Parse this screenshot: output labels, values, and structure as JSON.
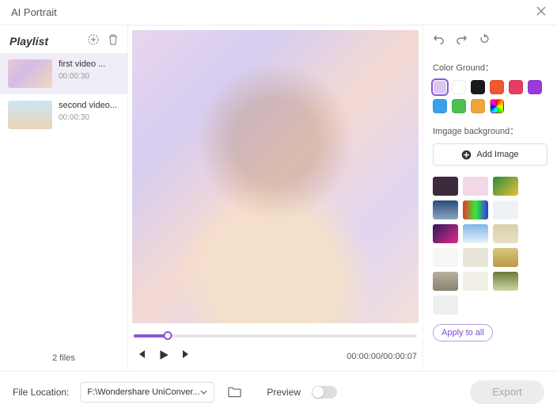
{
  "title": "AI Portrait",
  "playlist": {
    "heading": "Playlist",
    "items": [
      {
        "name": "first video ...",
        "duration": "00:00:30"
      },
      {
        "name": "second video...",
        "duration": "00:00:30"
      }
    ],
    "countLabel": "2 files"
  },
  "preview": {
    "time": "00:00:00/00:00:07"
  },
  "right": {
    "colorGroundLabel": "Color Ground：",
    "imageBgLabel": "Imgage background：",
    "addImageLabel": "Add Image",
    "applyLabel": "Apply to all",
    "colors": [
      "#d7c9f3",
      "#ffffff",
      "#1a1a1a",
      "#f0582e",
      "#e83c64",
      "#9b3ad6",
      "#3aa0ee",
      "#4fbf53",
      "#f1a43a",
      "rainbow"
    ],
    "selectedColorIndex": 0,
    "bgThumbs": [
      "#3b2b3c",
      "#f1d8e6",
      "linear-gradient(135deg,#2d8a3a,#e6c23a)",
      "linear-gradient(180deg,#2a4a7a,#8aa6c2)",
      "linear-gradient(90deg,#e33,#3e3,#33e)",
      "#eef2f5",
      "linear-gradient(135deg,#2b1a5a,#e32a8a)",
      "linear-gradient(180deg,#7db6e6,#e9f3fa)",
      "linear-gradient(180deg,#d9cfa8,#e9e0c4)",
      "#f6f6f6",
      "#e9e4d8",
      "linear-gradient(180deg,#d9c77a,#b89a4a)",
      "linear-gradient(180deg,#b8b0a0,#8a8270)",
      "#f2efe6",
      "linear-gradient(180deg,#6a7a3a,#cfd6a8)",
      "#eee"
    ]
  },
  "bottom": {
    "fileLocationLabel": "File Location:",
    "path": "F:\\Wondershare UniConver...",
    "previewLabel": "Preview",
    "exportLabel": "Export"
  }
}
